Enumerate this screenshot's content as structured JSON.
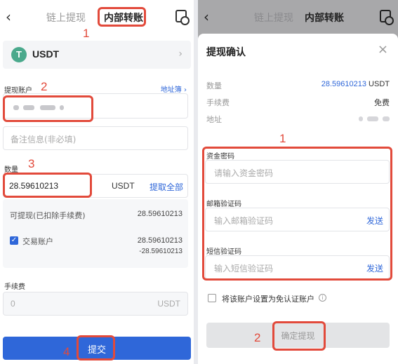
{
  "left": {
    "header": {
      "back": "‹",
      "tab_onchain": "链上提现",
      "tab_internal": "内部转账"
    },
    "coin": {
      "logo": "T",
      "name": "USDT",
      "chevron": "›"
    },
    "account": {
      "label": "提现账户",
      "address_book": "地址簿 ›"
    },
    "remark": {
      "placeholder": "备注信息(非必填)"
    },
    "amount": {
      "label": "数量",
      "value": "28.59610213",
      "unit": "USDT",
      "all": "提取全部"
    },
    "available": {
      "label": "可提现(已扣除手续费)",
      "value": "28.59610213"
    },
    "trade_account": {
      "label": "交易账户",
      "value": "28.59610213",
      "delta": "-28.59610213"
    },
    "fee": {
      "label": "手续费",
      "value": "0",
      "unit": "USDT"
    },
    "submit": "提交"
  },
  "right": {
    "header": {
      "back": "‹",
      "tab_onchain": "链上提现",
      "tab_internal": "内部转账"
    },
    "sheet": {
      "title": "提现确认",
      "close": "×",
      "quantity_label": "数量",
      "quantity_value": "28.59610213",
      "quantity_unit": " USDT",
      "fee_label": "手续费",
      "fee_value": "免费",
      "address_label": "地址",
      "fund_pw_label": "资金密码",
      "fund_pw_placeholder": "请输入资金密码",
      "email_label": "邮箱验证码",
      "email_placeholder": "输入邮箱验证码",
      "email_send": "发送",
      "sms_label": "短信验证码",
      "sms_placeholder": "输入短信验证码",
      "sms_send": "发送",
      "exempt_label": "将该账户设置为免认证账户",
      "info": "i",
      "confirm": "确定提现"
    }
  },
  "annotations": {
    "n1": "1",
    "n2": "2",
    "n3": "3",
    "n4": "4",
    "r1": "1",
    "r2": "2"
  },
  "colors": {
    "accent": "#2f67d9",
    "annotation": "#e24a3b",
    "usdt": "#4aa98c"
  },
  "icons": {
    "header_right": "document-clock-icon"
  }
}
